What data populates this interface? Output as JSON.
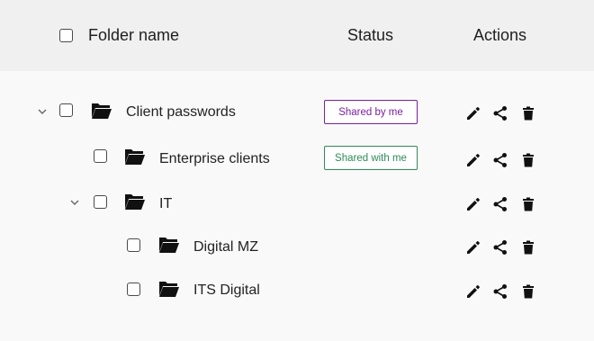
{
  "header": {
    "folder_name": "Folder name",
    "status": "Status",
    "actions": "Actions"
  },
  "rows": [
    {
      "name": "Client passwords",
      "status": "Shared by me",
      "expanded": true,
      "level": 0
    },
    {
      "name": "Enterprise clients",
      "status": "Shared with me",
      "expanded": false,
      "level": 1
    },
    {
      "name": "IT",
      "status": "",
      "expanded": true,
      "level": 1
    },
    {
      "name": "Digital MZ",
      "status": "",
      "expanded": false,
      "level": 2
    },
    {
      "name": "ITS Digital",
      "status": "",
      "expanded": false,
      "level": 2
    }
  ],
  "icons": {
    "expand": "chevron-down-icon",
    "folder": "folder-open-icon",
    "edit": "pencil-icon",
    "share": "share-icon",
    "delete": "trash-icon"
  },
  "colors": {
    "shared_by_me": "#7b1fa2",
    "shared_with_me": "#2e8b57",
    "header_bg": "#f0f0f0",
    "body_bg": "#f9f9f9"
  }
}
